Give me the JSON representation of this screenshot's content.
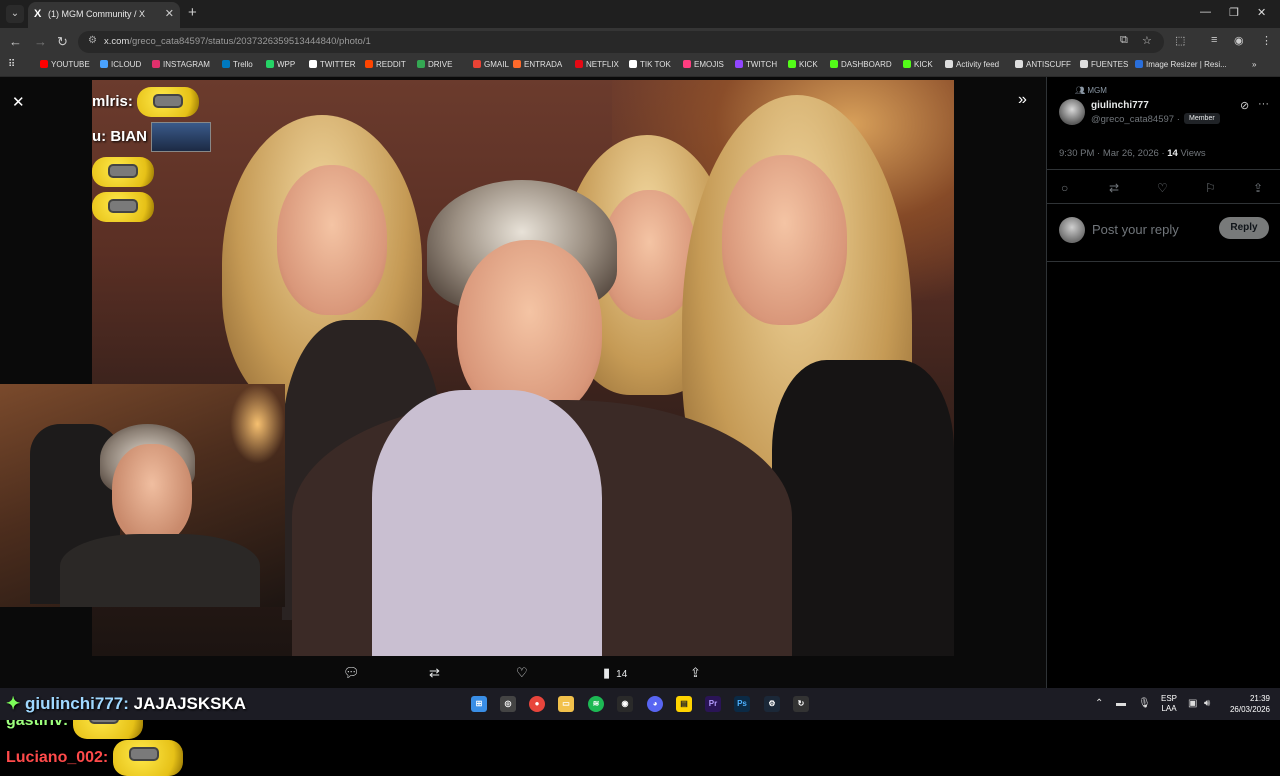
{
  "browser": {
    "tab_title": "(1) MGM Community / X",
    "tab_favicon": "X",
    "url_host": "x.com",
    "url_path": "/greco_cata84597/status/2037326359513444840/photo/1",
    "bookmarks": [
      {
        "label": "YOUTUBE",
        "color": "#ff0000"
      },
      {
        "label": "ICLOUD",
        "color": "#4aa3ff"
      },
      {
        "label": "INSTAGRAM",
        "color": "#e1306c"
      },
      {
        "label": "Trello",
        "color": "#0079bf"
      },
      {
        "label": "WPP",
        "color": "#25d366"
      },
      {
        "label": "TWITTER",
        "color": "#ffffff"
      },
      {
        "label": "REDDIT",
        "color": "#ff4500"
      },
      {
        "label": "DRIVE",
        "color": "#34a853"
      },
      {
        "label": "GMAIL",
        "color": "#ea4335"
      },
      {
        "label": "ENTRADA",
        "color": "#ff6a2b"
      },
      {
        "label": "NETFLIX",
        "color": "#e50914"
      },
      {
        "label": "TIK TOK",
        "color": "#ffffff"
      },
      {
        "label": "EMOJIS",
        "color": "#ff3d7f"
      },
      {
        "label": "TWITCH",
        "color": "#9146ff"
      },
      {
        "label": "KICK",
        "color": "#53fc18"
      },
      {
        "label": "DASHBOARD",
        "color": "#53fc18"
      },
      {
        "label": "KICK",
        "color": "#53fc18"
      },
      {
        "label": "Activity feed",
        "color": "#dddddd"
      },
      {
        "label": "ANTISCUFF",
        "color": "#dddddd"
      },
      {
        "label": "FUENTES",
        "color": "#dddddd"
      },
      {
        "label": "Image Resizer | Resi...",
        "color": "#2a6fdb"
      }
    ]
  },
  "overlay": {
    "chat_top": [
      {
        "user": "mlris:",
        "text": ""
      },
      {
        "user": "u: BIAN",
        "text": ""
      }
    ],
    "stream_chat": [
      {
        "user": "gastiriv:",
        "color": "#7dff5a"
      },
      {
        "user": "Luciano_002:",
        "color": "#ff5050"
      }
    ],
    "taskbar_chat": {
      "user": "giulinchi777:",
      "text": "JAJAJSKSKA"
    }
  },
  "photo_actions": {
    "views": "14"
  },
  "post": {
    "community": "MGM",
    "display_name": "giulinchi777",
    "handle": "@greco_cata84597 ·",
    "badge": "Member",
    "time": "9:30 PM · Mar 26, 2026 ·",
    "views_count": "14",
    "views_label": "Views",
    "reply_placeholder": "Post your reply",
    "reply_button": "Reply"
  },
  "taskbar": {
    "lang": "ESP",
    "region": "LAA",
    "time": "21:39",
    "date": "26/03/2026"
  }
}
